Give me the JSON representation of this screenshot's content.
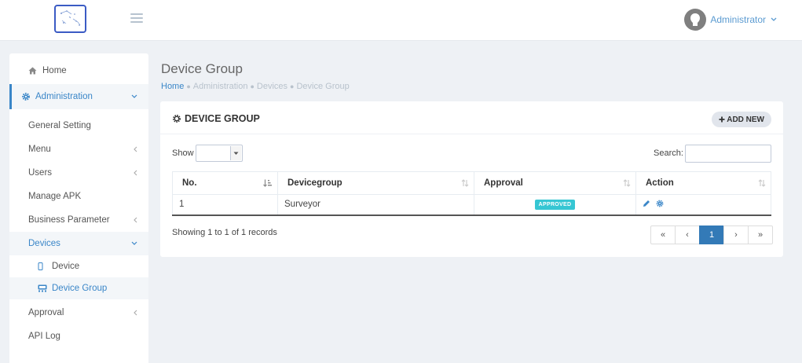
{
  "header": {
    "user_name": "Administrator"
  },
  "sidebar": {
    "items": [
      {
        "label": "Home",
        "icon": "home-icon"
      },
      {
        "label": "Administration",
        "icon": "gear-icon"
      },
      {
        "label": "General Setting"
      },
      {
        "label": "Menu"
      },
      {
        "label": "Users"
      },
      {
        "label": "Manage APK"
      },
      {
        "label": "Business Parameter"
      },
      {
        "label": "Devices"
      },
      {
        "label": "Device",
        "icon": "mobile-icon"
      },
      {
        "label": "Device Group",
        "icon": "device-group-icon"
      },
      {
        "label": "Approval"
      },
      {
        "label": "API Log"
      }
    ]
  },
  "page": {
    "title": "Device Group",
    "breadcrumb": [
      "Home",
      "Administration",
      "Devices",
      "Device Group"
    ]
  },
  "portlet": {
    "title": "DEVICE GROUP",
    "add_label": "ADD NEW",
    "show_label": "Show",
    "search_label": "Search:",
    "search_value": "",
    "columns": [
      "No.",
      "Devicegroup",
      "Approval",
      "Action"
    ],
    "rows": [
      {
        "no": "1",
        "devicegroup": "Surveyor",
        "approval": "APPROVED"
      }
    ],
    "showing_text": "Showing 1 to 1 of 1 records",
    "pagination": [
      "«",
      "‹",
      "1",
      "›",
      "»"
    ],
    "current_page": "1"
  },
  "colors": {
    "accent": "#3a86c8",
    "badge": "#36c6d3",
    "pager_active": "#337ab7"
  }
}
